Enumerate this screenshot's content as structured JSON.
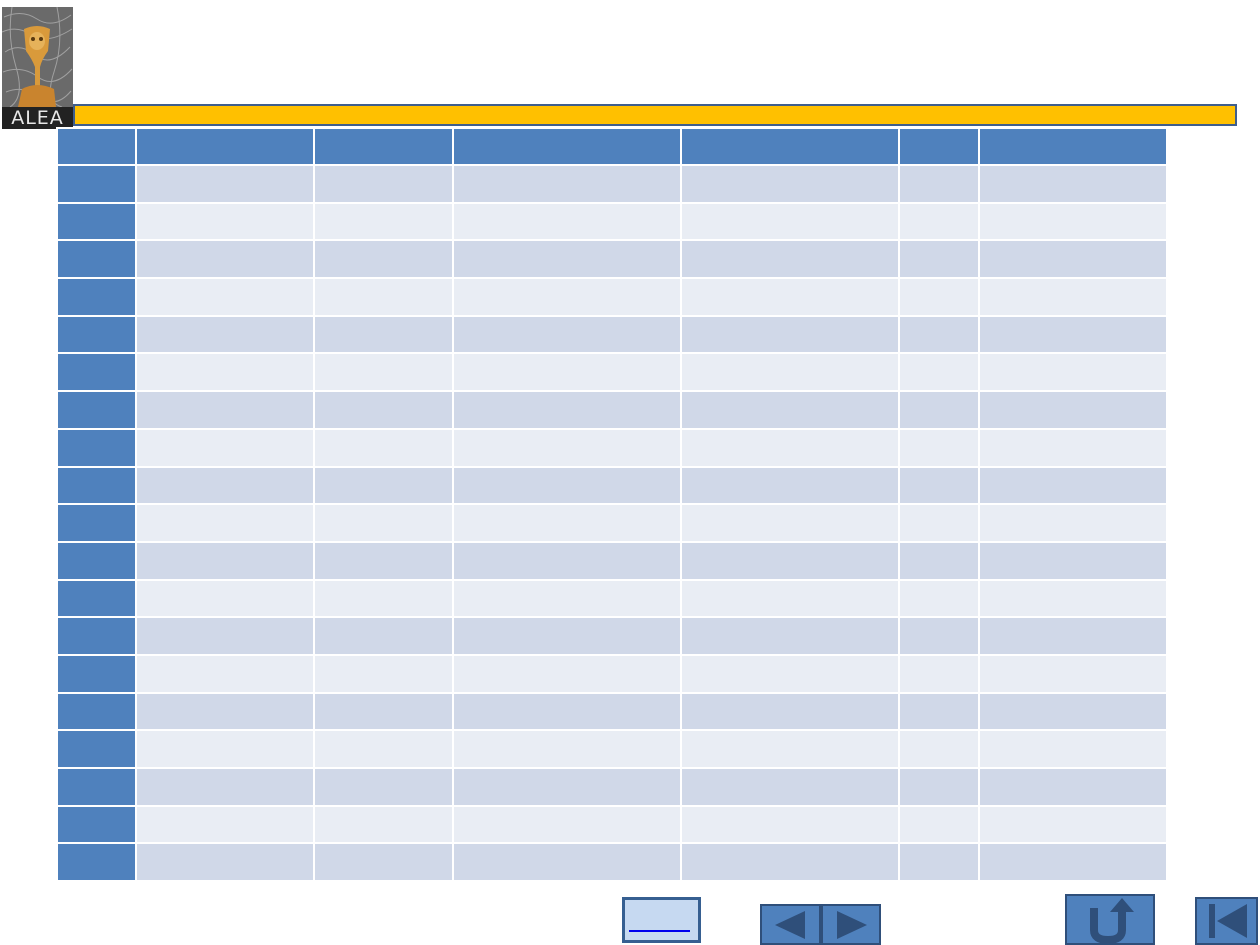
{
  "logo": {
    "text": "ALEA"
  },
  "table": {
    "columns": 7,
    "rows": 19
  },
  "colors": {
    "title_bar": "#ffc000",
    "header": "#4f81bd",
    "row_odd": "#d0d8e8",
    "row_even": "#e9edf4",
    "button": "#4f81bd",
    "link_button": "#c6d9f1"
  },
  "navigation": {
    "icons": [
      "previous-icon",
      "next-icon",
      "return-icon",
      "first-page-icon"
    ]
  }
}
